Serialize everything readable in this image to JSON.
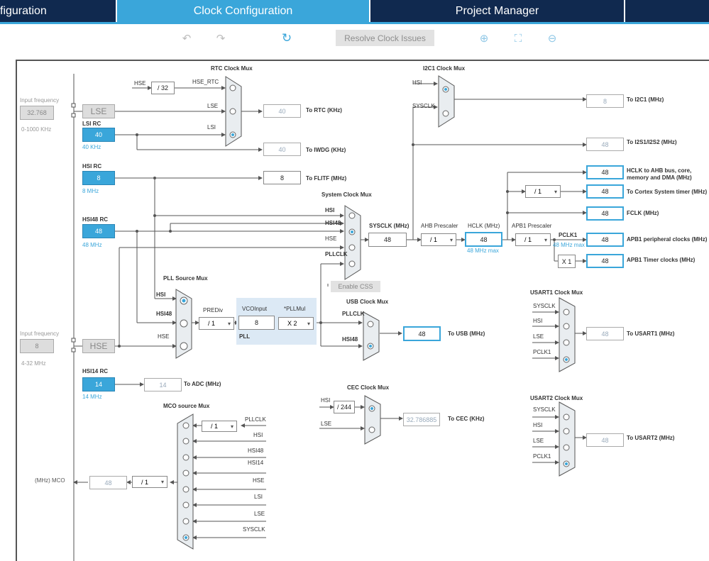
{
  "tabs": [
    {
      "label": "figuration",
      "active": false
    },
    {
      "label": "Clock Configuration",
      "active": true
    },
    {
      "label": "Project Manager",
      "active": false
    },
    {
      "label": "",
      "active": false
    }
  ],
  "toolbar": {
    "undo_icon": "undo-icon",
    "redo_icon": "redo-icon",
    "refresh_icon": "refresh-icon",
    "resolve_label": "Resolve Clock Issues",
    "zoom_in_icon": "zoom-in-icon",
    "fit_icon": "fit-icon",
    "zoom_out_icon": "zoom-out-icon"
  },
  "colors": {
    "accent": "#3aa6da",
    "navy": "#10294f",
    "pll_panel": "#dce9f5"
  },
  "inputs": {
    "lse": {
      "label_input_freq": "Input frequency",
      "value": "32.768",
      "range": "0-1000 KHz",
      "name": "LSE"
    },
    "hse": {
      "label_input_freq": "Input frequency",
      "value": "8",
      "range": "4-32 MHz",
      "name": "HSE"
    }
  },
  "oscillators": {
    "lsi": {
      "label": "LSI RC",
      "value": "40",
      "freq": "40 KHz"
    },
    "hsi": {
      "label": "HSI RC",
      "value": "8",
      "freq": "8 MHz"
    },
    "hsi48": {
      "label": "HSI48 RC",
      "value": "48",
      "freq": "48 MHz"
    },
    "hsi14": {
      "label": "HSI14 RC",
      "value": "14",
      "freq": "14 MHz"
    }
  },
  "rtc": {
    "title": "RTC Clock Mux",
    "hse_label": "HSE",
    "div": "/ 32",
    "hse_rtc": "HSE_RTC",
    "lse": "LSE",
    "lsi": "LSI",
    "rtc_value": "40",
    "rtc_label": "To RTC (KHz)",
    "iwdg_value": "40",
    "iwdg_label": "To IWDG (KHz)"
  },
  "flitf": {
    "value": "8",
    "label": "To FLITF (MHz)"
  },
  "sysclk_mux": {
    "title": "System Clock Mux",
    "hsi": "HSI",
    "hsi48": "HSI48",
    "hse": "HSE",
    "pllclk": "PLLCLK",
    "enable_css": "Enable CSS"
  },
  "sysclk": {
    "label": "SYSCLK (MHz)",
    "value": "48"
  },
  "ahb": {
    "label": "AHB Prescaler",
    "value": "/ 1"
  },
  "hclk": {
    "label": "HCLK (MHz)",
    "value": "48",
    "max": "48 MHz max"
  },
  "apb1": {
    "label": "APB1 Prescaler",
    "value": "/ 1",
    "pclk1": "PCLK1",
    "max": "48 MHz max",
    "x1": "X 1"
  },
  "outputs": {
    "hclk_ahb": {
      "value": "48",
      "label": "HCLK to AHB bus, core, memory and DMA (MHz)"
    },
    "cortex": {
      "div": "/ 1",
      "value": "48",
      "label": "To Cortex System timer (MHz)"
    },
    "fclk": {
      "value": "48",
      "label": "FCLK (MHz)"
    },
    "apb1_periph": {
      "value": "48",
      "label": "APB1 peripheral clocks (MHz)"
    },
    "apb1_timer": {
      "value": "48",
      "label": "APB1 Timer clocks (MHz)"
    }
  },
  "i2c1": {
    "title": "I2C1 Clock Mux",
    "hsi": "HSI",
    "sysclk": "SYSCLK",
    "value": "8",
    "label": "To I2C1 (MHz)"
  },
  "i2s": {
    "value": "48",
    "label": "To I2S1/I2S2 (MHz)"
  },
  "pll_source": {
    "title": "PLL Source Mux",
    "hsi": "HSI",
    "hsi48": "HSI48",
    "hse": "HSE"
  },
  "pll": {
    "prediv_label": "PREDiv",
    "prediv": "/ 1",
    "vco_label": "VCOInput",
    "vco": "8",
    "mul_label": "*PLLMul",
    "mul": "X 2",
    "name": "PLL"
  },
  "usb": {
    "title": "USB Clock Mux",
    "pllclk": "PLLCLK",
    "hsi48": "HSI48",
    "value": "48",
    "label": "To USB (MHz)"
  },
  "usart1": {
    "title": "USART1 Clock Mux",
    "inputs": [
      "SYSCLK",
      "HSI",
      "LSE",
      "PCLK1"
    ],
    "value": "48",
    "label": "To USART1 (MHz)"
  },
  "usart2": {
    "title": "USART2 Clock Mux",
    "inputs": [
      "SYSCLK",
      "HSI",
      "LSE",
      "PCLK1"
    ],
    "value": "48",
    "label": "To USART2 (MHz)"
  },
  "adc": {
    "value": "14",
    "label": "To ADC (MHz)"
  },
  "cec": {
    "title": "CEC Clock Mux",
    "hsi": "HSI",
    "div": "/ 244",
    "lse": "LSE",
    "value": "32.786885",
    "label": "To CEC (KHz)"
  },
  "mco": {
    "title": "MCO source Mux",
    "label": "(MHz) MCO",
    "value": "48",
    "div": "/ 1",
    "pll_div": "/ 1",
    "inputs": [
      "PLLCLK",
      "HSI",
      "HSI48",
      "HSI14",
      "HSE",
      "LSI",
      "LSE",
      "SYSCLK"
    ]
  }
}
